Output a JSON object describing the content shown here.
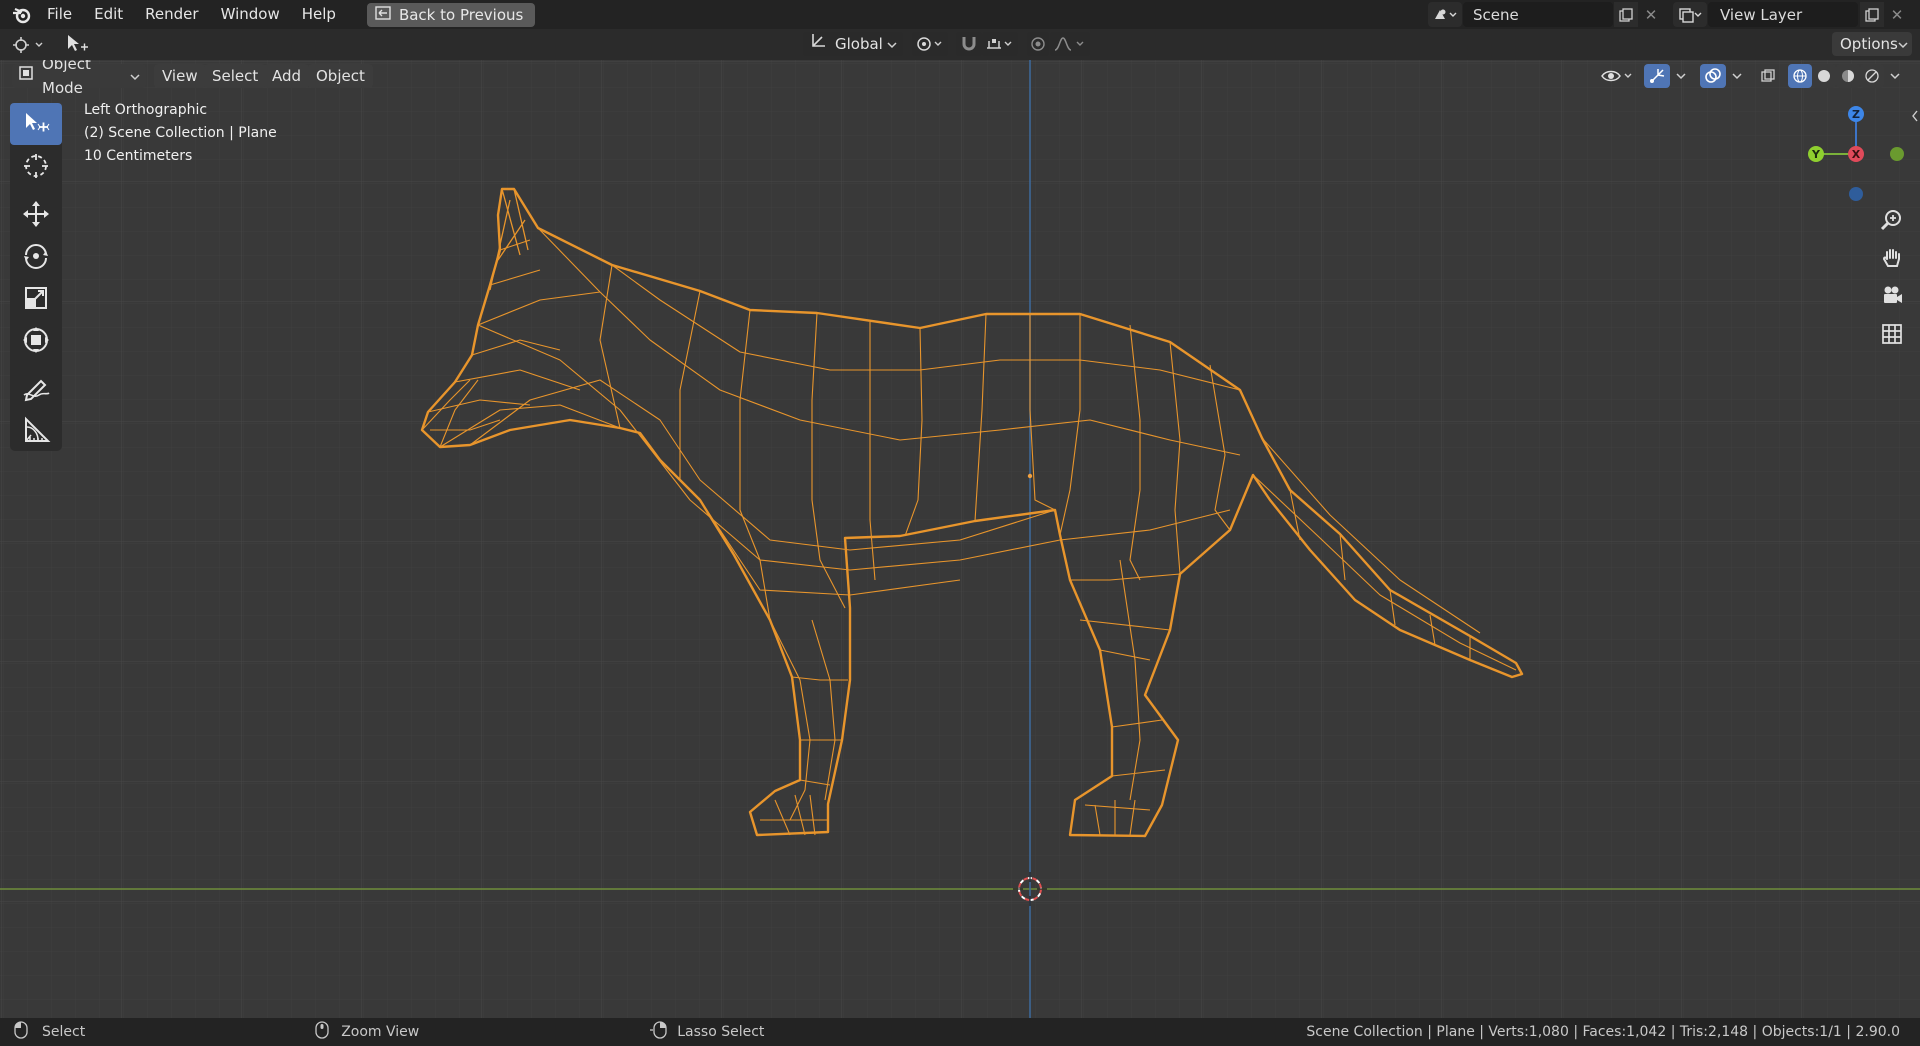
{
  "menu": [
    "File",
    "Edit",
    "Render",
    "Window",
    "Help"
  ],
  "back_button": "Back to Previous",
  "scene": {
    "label": "Scene"
  },
  "view_layer": {
    "label": "View Layer"
  },
  "header": {
    "transform_orientation": "Global",
    "options": "Options"
  },
  "viewport_header": {
    "mode": "Object Mode",
    "menus": [
      "View",
      "Select",
      "Add",
      "Object"
    ]
  },
  "overlay": {
    "view_name": "Left Orthographic",
    "collection": "(2) Scene Collection | Plane",
    "scale": "10 Centimeters"
  },
  "gizmo": {
    "z": "Z",
    "y": "Y",
    "x": "X"
  },
  "status": {
    "left": "Select",
    "middle": "Zoom View",
    "right_hint": "Lasso Select",
    "stats": "Scene Collection | Plane | Verts:1,080 | Faces:1,042 | Tris:2,148 | Objects:1/1 | 2.90.0"
  },
  "colors": {
    "mesh": "#e8952c",
    "background": "#393939",
    "grid": "#444444",
    "x_axis": "#7a9a3c",
    "z_axis": "#3c6ea8"
  }
}
